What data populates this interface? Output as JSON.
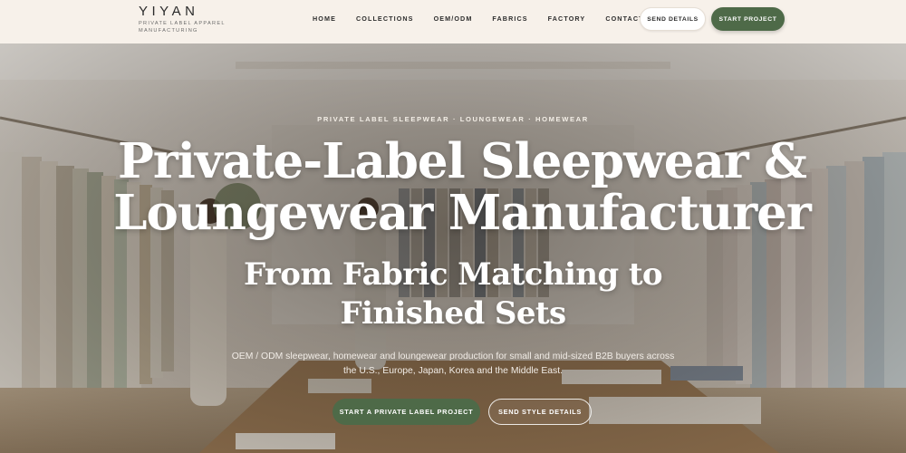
{
  "brand": {
    "name": "YIYAN",
    "tagline": "PRIVATE LABEL APPAREL MANUFACTURING"
  },
  "nav": {
    "items": [
      "HOME",
      "COLLECTIONS",
      "OEM/ODM",
      "FABRICS",
      "FACTORY",
      "CONTACT"
    ]
  },
  "header_buttons": {
    "send_details": "SEND DETAILS",
    "start_project": "START PROJECT"
  },
  "hero": {
    "eyebrow": "PRIVATE LABEL SLEEPWEAR · LOUNGEWEAR · HOMEWEAR",
    "headline": "Private-Label Sleepwear & Loungewear Manufacturer",
    "subhead": "From Fabric Matching to Finished Sets",
    "description": "OEM / ODM sleepwear, homewear and loungewear production for small and mid-sized B2B buyers across the U.S., Europe, Japan, Korea and the Middle East.",
    "cta_primary": "START A PRIVATE LABEL PROJECT",
    "cta_secondary": "SEND STYLE DETAILS"
  },
  "colors": {
    "accent_green": "#4e6a48",
    "header_bg": "#f7f1ea"
  }
}
